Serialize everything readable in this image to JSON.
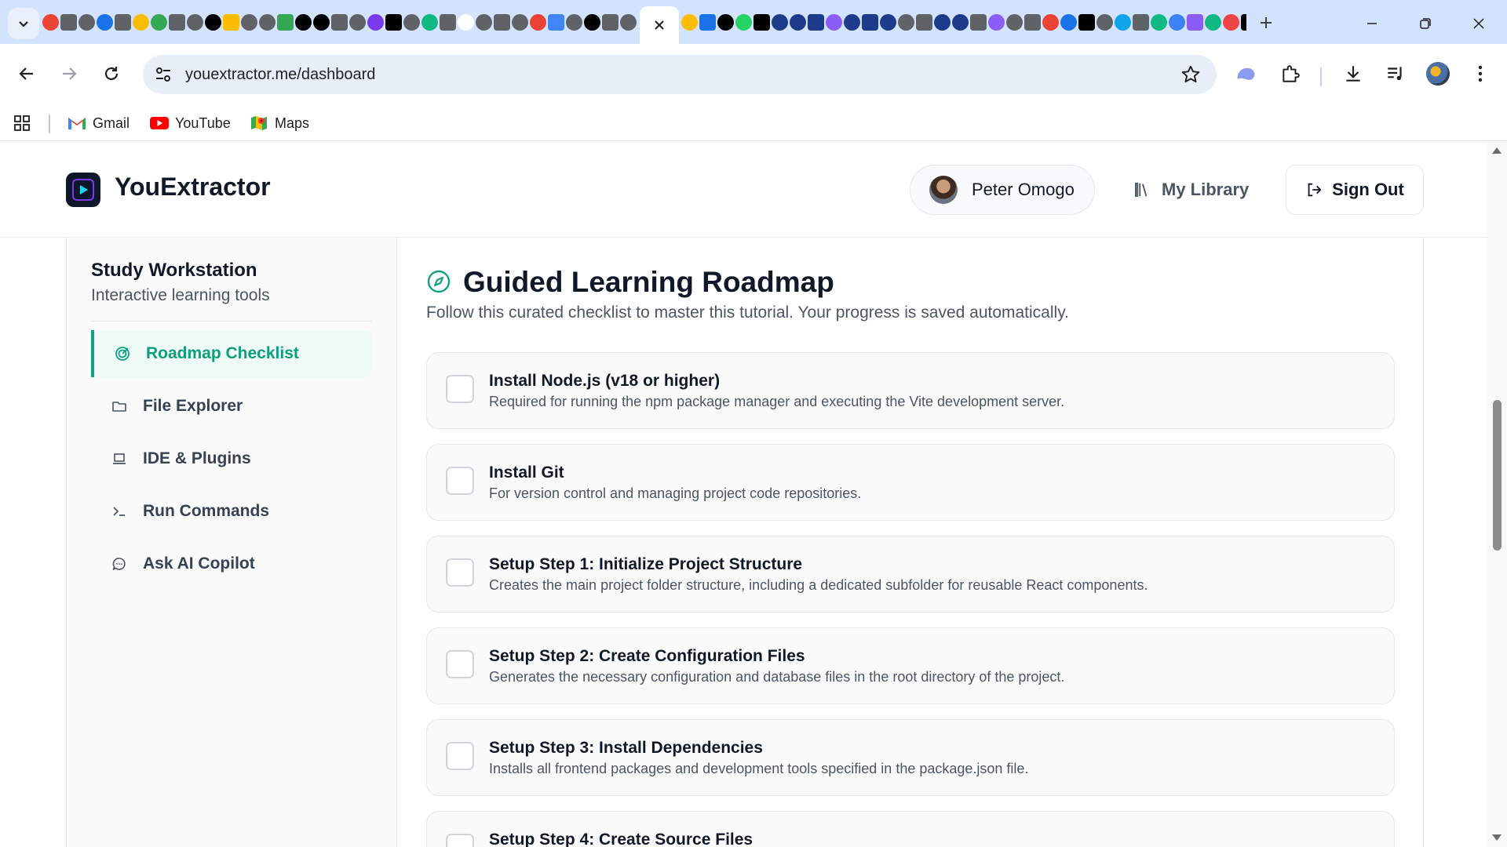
{
  "browser": {
    "tabs_left_favicon_colors": [
      "#ea4335",
      "#5f6368",
      "#5f6368",
      "#1a73e8",
      "#5f6368",
      "#fbbc04",
      "#34a853",
      "#5f6368",
      "#5f6368",
      "#000000",
      "#fbbc04",
      "#5f6368",
      "#5f6368",
      "#34a853",
      "#000000",
      "#000000",
      "#5f6368",
      "#5f6368",
      "#7c3aed",
      "#000000",
      "#5f6368",
      "#10b981",
      "#5f6368",
      "#ffffff",
      "#5f6368",
      "#5f6368",
      "#5f6368",
      "#ea4335",
      "#4285f4",
      "#5f6368",
      "#000000",
      "#5f6368",
      "#5f6368"
    ],
    "tabs_right_favicon_colors": [
      "#fbbc04",
      "#1a73e8",
      "#000000",
      "#25d366",
      "#000000",
      "#1e3a8a",
      "#1e3a8a",
      "#1e3a8a",
      "#8b5cf6",
      "#1e3a8a",
      "#1e3a8a",
      "#1e3a8a",
      "#5f6368",
      "#5f6368",
      "#1e3a8a",
      "#1e3a8a",
      "#5f6368",
      "#8b5cf6",
      "#5f6368",
      "#5f6368",
      "#ea4335",
      "#1a73e8",
      "#000000",
      "#5f6368",
      "#0ea5e9",
      "#5f6368",
      "#10b981",
      "#3b82f6",
      "#8b5cf6",
      "#10b981",
      "#ef4444",
      "#000000"
    ],
    "active_tab_close_icon": "close-icon",
    "url": "youextractor.me/dashboard",
    "bookmarks": [
      {
        "label": "Gmail",
        "icon": "gmail-icon",
        "color": "#ea4335"
      },
      {
        "label": "YouTube",
        "icon": "youtube-icon",
        "color": "#ff0000"
      },
      {
        "label": "Maps",
        "icon": "maps-icon",
        "color": "#34a853"
      }
    ]
  },
  "header": {
    "brand": "YouExtractor",
    "user_name": "Peter Omogo",
    "library_label": "My Library",
    "signout_label": "Sign Out"
  },
  "sidebar": {
    "title": "Study Workstation",
    "subtitle": "Interactive learning tools",
    "items": [
      {
        "label": "Roadmap Checklist",
        "icon": "target-icon",
        "active": true
      },
      {
        "label": "File Explorer",
        "icon": "folder-icon",
        "active": false
      },
      {
        "label": "IDE & Plugins",
        "icon": "laptop-icon",
        "active": false
      },
      {
        "label": "Run Commands",
        "icon": "terminal-icon",
        "active": false
      },
      {
        "label": "Ask AI Copilot",
        "icon": "chat-icon",
        "active": false
      }
    ]
  },
  "main": {
    "title": "Guided Learning Roadmap",
    "subtitle": "Follow this curated checklist to master this tutorial. Your progress is saved automatically.",
    "tasks": [
      {
        "title": "Install Node.js (v18 or higher)",
        "desc": "Required for running the npm package manager and executing the Vite development server.",
        "checked": false
      },
      {
        "title": "Install Git",
        "desc": "For version control and managing project code repositories.",
        "checked": false
      },
      {
        "title": "Setup Step 1: Initialize Project Structure",
        "desc": "Creates the main project folder structure, including a dedicated subfolder for reusable React components.",
        "checked": false
      },
      {
        "title": "Setup Step 2: Create Configuration Files",
        "desc": "Generates the necessary configuration and database files in the root directory of the project.",
        "checked": false
      },
      {
        "title": "Setup Step 3: Install Dependencies",
        "desc": "Installs all frontend packages and development tools specified in the package.json file.",
        "checked": false
      },
      {
        "title": "Setup Step 4: Create Source Files",
        "desc": "",
        "checked": false
      }
    ]
  },
  "colors": {
    "accent": "#14a085",
    "tabstrip": "#d3e3fd",
    "omnibox": "#e8eef7"
  }
}
